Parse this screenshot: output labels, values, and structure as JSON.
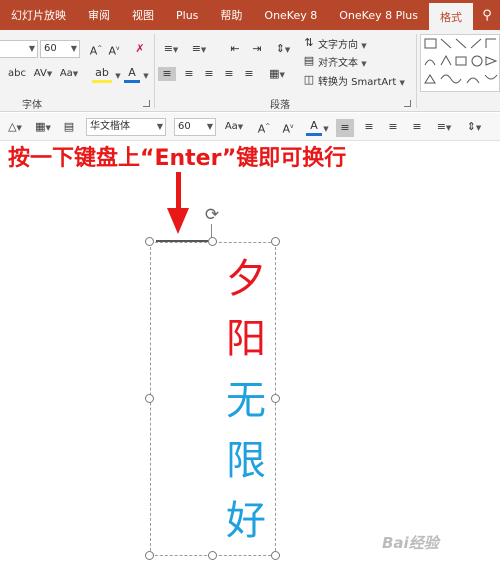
{
  "ribbon_tabs": [
    "幻灯片放映",
    "审阅",
    "视图",
    "Plus",
    "帮助",
    "OneKey 8",
    "OneKey 8 Plus",
    "格式"
  ],
  "active_tab": "格式",
  "font_group": {
    "label": "字体",
    "font_size": "60",
    "change_case_label": "Aa"
  },
  "paragraph_group": {
    "label": "段落",
    "text_direction": "文字方向",
    "align_text": "对齐文本",
    "convert_smartart": "转换为 SmartArt"
  },
  "mini_toolbar": {
    "font_name": "华文楷体",
    "font_size": "60",
    "change_case_label": "Aa"
  },
  "instruction": "按一下键盘上“Enter”键即可换行",
  "textbox": {
    "chars": [
      "夕",
      "阳",
      "无",
      "限",
      "好"
    ],
    "colors": [
      "#e8161e",
      "#e8161e",
      "#1fa0df",
      "#1fa0df",
      "#1fa0df"
    ]
  },
  "watermark": "Bai经验",
  "accent_color": "#b7472a",
  "instruction_color": "#e81818"
}
